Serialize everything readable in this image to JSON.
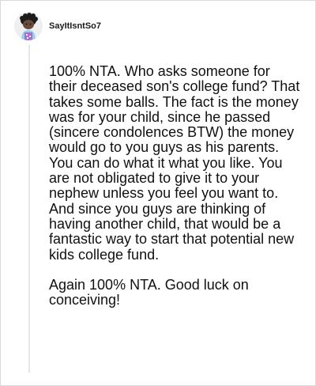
{
  "comment": {
    "author": "SayItIsntSo7",
    "avatar_icon": "snoo-avatar-icon",
    "paragraphs": [
      "100% NTA. Who asks someone for their deceased son's college fund? That takes some balls. The fact is the money was for your child, since he passed (sincere condolences BTW) the money would go to you guys as his parents. You can do what it what you like. You are not obligated to give it to your nephew unless you feel you want to. And since you guys are thinking of having another child, that would be a fantastic way to start that potential new kids college fund.",
      "Again 100% NTA. Good luck on conceiving!"
    ]
  },
  "colors": {
    "text": "#111111",
    "username": "#1a1a1b",
    "thread_line": "#e6e6e6",
    "border": "#d9d9d9"
  }
}
